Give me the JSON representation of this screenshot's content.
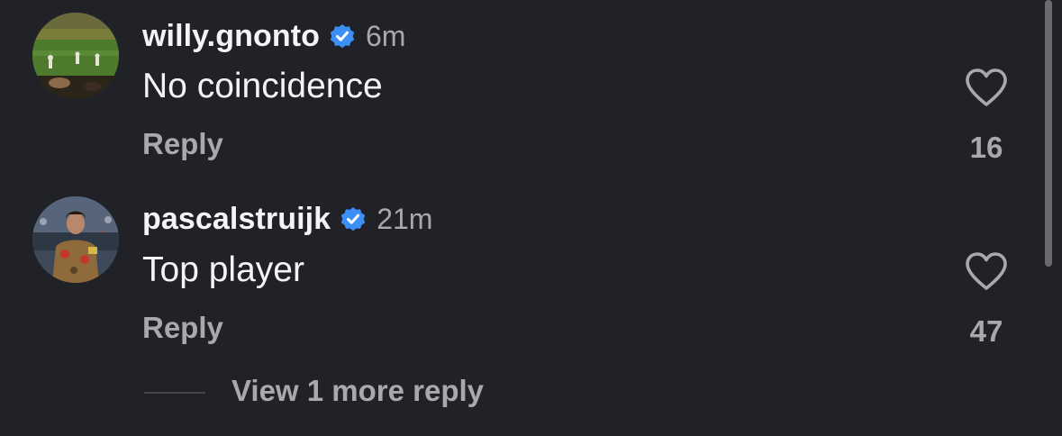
{
  "comments": [
    {
      "username": "willy.gnonto",
      "verified": true,
      "time": "6m",
      "text": "No coincidence",
      "reply_label": "Reply",
      "likes": "16",
      "avatar_icon": "stadium-crowd-avatar"
    },
    {
      "username": "pascalstruijk",
      "verified": true,
      "time": "21m",
      "text": "Top player",
      "reply_label": "Reply",
      "likes": "47",
      "avatar_icon": "player-portrait-avatar"
    }
  ],
  "view_more_replies": "View 1 more reply",
  "colors": {
    "background": "#212227",
    "primary_text": "#f4f4f6",
    "secondary_text": "#a8a9ae",
    "verified_badge": "#3b8ff6"
  },
  "icons": {
    "verified": "verified-badge-icon",
    "like": "heart-outline-icon"
  }
}
